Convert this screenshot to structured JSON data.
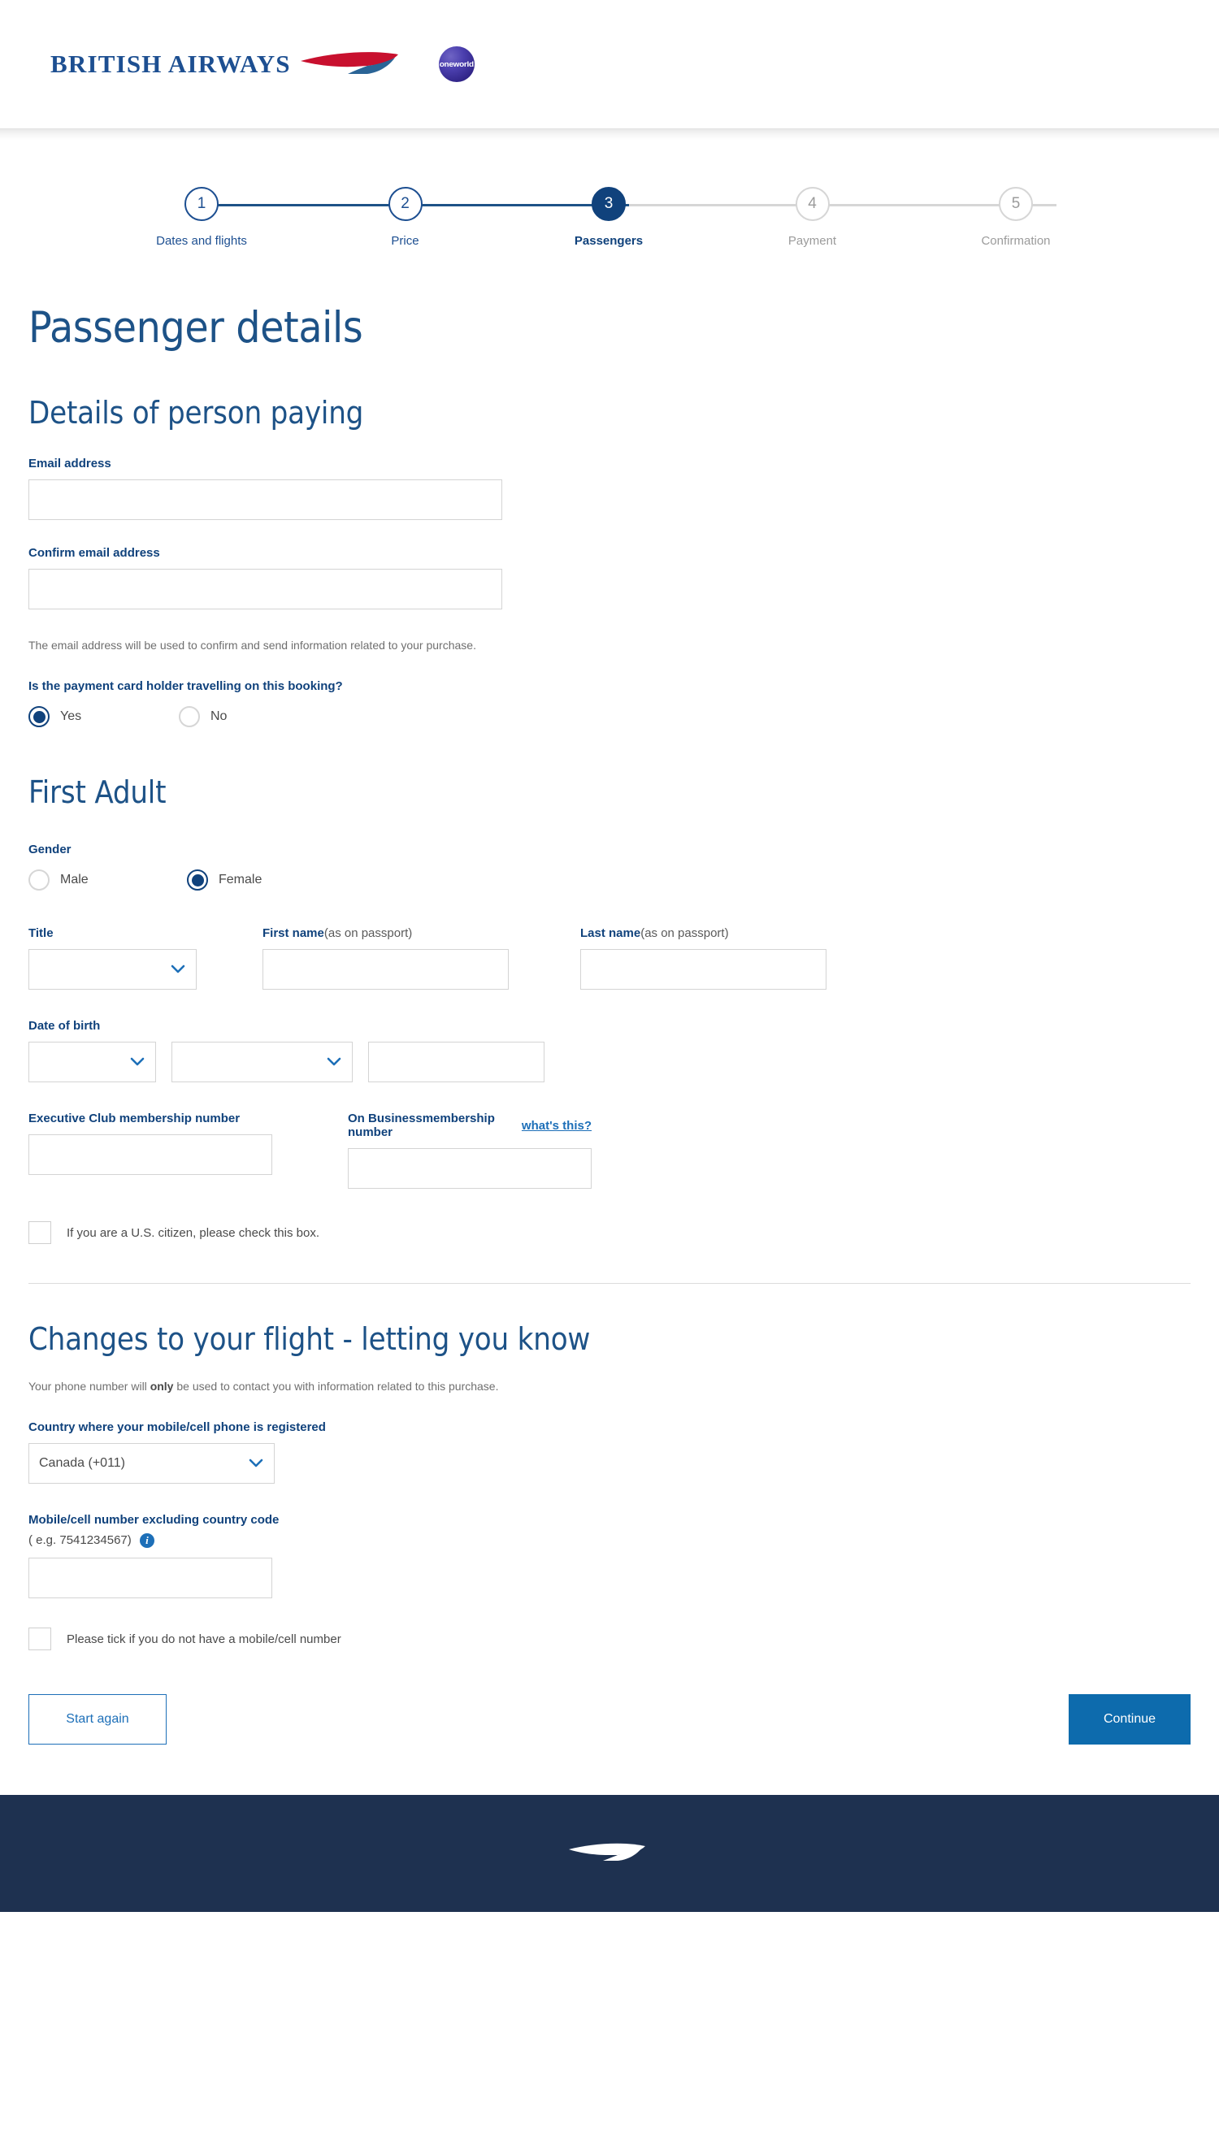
{
  "header": {
    "brand_wordmark": "BRITISH AIRWAYS",
    "alliance_logo_text": "oneworld",
    "brand_blue": "#1d4f91",
    "brand_red": "#c8102e"
  },
  "stepper": {
    "steps": [
      {
        "number": "1",
        "label": "Dates and flights",
        "state": "done"
      },
      {
        "number": "2",
        "label": "Price",
        "state": "done"
      },
      {
        "number": "3",
        "label": "Passengers",
        "state": "active"
      },
      {
        "number": "4",
        "label": "Payment",
        "state": "pending"
      },
      {
        "number": "5",
        "label": "Confirmation",
        "state": "pending"
      }
    ],
    "active_color": "#10427c",
    "done_color": "#1d5287",
    "pending_color": "#d6d6d6"
  },
  "page": {
    "title": "Passenger details"
  },
  "payer_section": {
    "heading": "Details of person paying",
    "email_label": "Email address",
    "email_value": "",
    "confirm_email_label": "Confirm email address",
    "confirm_email_value": "",
    "helper_text": "The email address will be used to confirm and send information related to your purchase.",
    "cardholder_question": "Is the payment card holder travelling on this booking?",
    "cardholder_options": [
      {
        "label": "Yes",
        "selected": true
      },
      {
        "label": "No",
        "selected": false
      }
    ]
  },
  "passenger_section": {
    "heading": "First Adult",
    "gender_label": "Gender",
    "gender_options": [
      {
        "label": "Male",
        "selected": false
      },
      {
        "label": "Female",
        "selected": true
      }
    ],
    "title_label": "Title",
    "title_value": "",
    "first_name_label": "First name",
    "first_name_sub": "(as on passport)",
    "first_name_value": "",
    "last_name_label": "Last name",
    "last_name_sub": "(as on passport)",
    "last_name_value": "",
    "dob_label": "Date of birth",
    "dob_day_value": "",
    "dob_month_value": "",
    "dob_year_value": "",
    "exec_club_label": "Executive Club membership number",
    "exec_club_value": "",
    "on_business_label": "On Businessmembership number",
    "on_business_value": "",
    "whats_this_link": "what's this?",
    "us_citizen_label": "If you are a U.S. citizen, please check this box.",
    "us_citizen_checked": false
  },
  "changes_section": {
    "heading": "Changes to your flight - letting you know",
    "intro_before": "Your phone number will ",
    "intro_bold": "only",
    "intro_after": " be used to contact you with information related to this purchase.",
    "country_label": "Country where your mobile/cell phone is registered",
    "country_value": "Canada (+011)",
    "mobile_label": "Mobile/cell number excluding country code",
    "mobile_example": "( e.g. 7541234567)",
    "mobile_value": "",
    "no_mobile_label": "Please tick if you do not have a mobile/cell number",
    "no_mobile_checked": false
  },
  "actions": {
    "start_again_label": "Start again",
    "continue_label": "Continue",
    "primary_color": "#0d6bad",
    "link_color": "#1d6fb8"
  },
  "footer": {
    "background_color": "#1e3150"
  }
}
